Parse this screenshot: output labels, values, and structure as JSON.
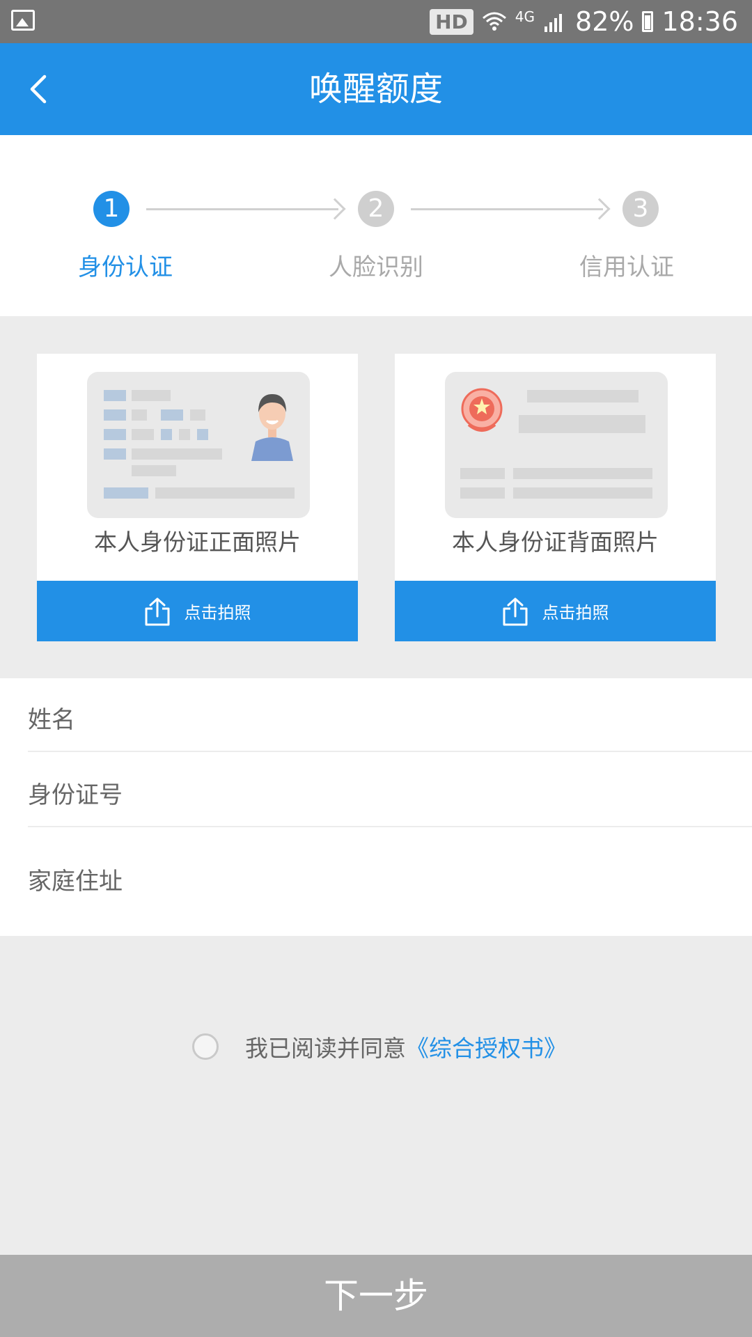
{
  "status_bar": {
    "hd_label": "HD",
    "network_label": "4G",
    "battery_text": "82%",
    "time": "18:36"
  },
  "header": {
    "title": "唤醒额度"
  },
  "stepper": {
    "steps": [
      {
        "number": "1",
        "label": "身份认证",
        "state": "active"
      },
      {
        "number": "2",
        "label": "人脸识别",
        "state": "inactive"
      },
      {
        "number": "3",
        "label": "信用认证",
        "state": "inactive"
      }
    ]
  },
  "id_cards": [
    {
      "caption": "本人身份证正面照片",
      "button_label": "点击拍照"
    },
    {
      "caption": "本人身份证背面照片",
      "button_label": "点击拍照"
    }
  ],
  "form": {
    "fields": [
      {
        "label": "姓名",
        "value": ""
      },
      {
        "label": "身份证号",
        "value": ""
      },
      {
        "label": "家庭住址",
        "value": ""
      }
    ]
  },
  "agreement": {
    "text": "我已阅读并同意",
    "link": "《综合授权书》",
    "checked": false
  },
  "next_button": {
    "label": "下一步"
  },
  "colors": {
    "accent": "#2290e6",
    "status_bar": "#757575",
    "page_bg": "#ececec",
    "disabled_button": "#adadad"
  }
}
